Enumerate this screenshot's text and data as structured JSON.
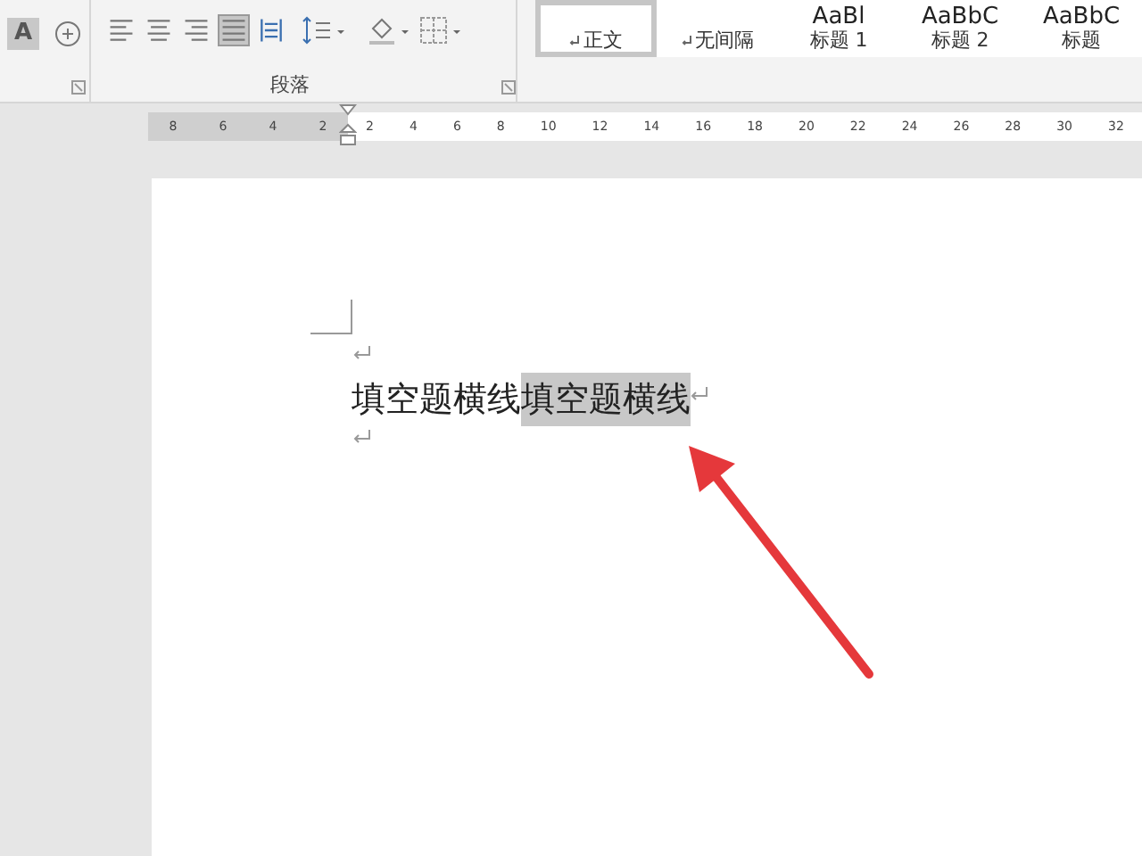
{
  "ribbon": {
    "text_effects_glyph": "A",
    "paragraph_group": {
      "label": "段落",
      "alignment": [
        {
          "selected": false
        },
        {
          "selected": false
        },
        {
          "selected": false
        },
        {
          "selected": true
        },
        {
          "selected": false
        }
      ]
    },
    "styles": [
      {
        "label": "正文",
        "selected": true,
        "linked": true
      },
      {
        "label": "无间隔",
        "selected": false,
        "linked": true
      },
      {
        "preview": "AaBl",
        "label": "标题 1",
        "selected": false,
        "linked": false
      },
      {
        "preview": "AaBbC",
        "label": "标题 2",
        "selected": false,
        "linked": false
      },
      {
        "preview": "AaBbC",
        "label": "标题",
        "selected": false,
        "linked": false
      }
    ]
  },
  "ruler": {
    "left_labels": [
      "8",
      "6",
      "4",
      "2"
    ],
    "right_labels": [
      "2",
      "4",
      "6",
      "8",
      "10",
      "12",
      "14",
      "16",
      "18",
      "20",
      "22",
      "24",
      "26",
      "28",
      "30",
      "32"
    ]
  },
  "document": {
    "paragraphs": [
      {
        "kind": "empty"
      },
      {
        "kind": "text",
        "segments": [
          {
            "text": "填空题横线",
            "selected": false
          },
          {
            "text": "填空题横线",
            "selected": true
          }
        ]
      },
      {
        "kind": "empty"
      }
    ]
  }
}
